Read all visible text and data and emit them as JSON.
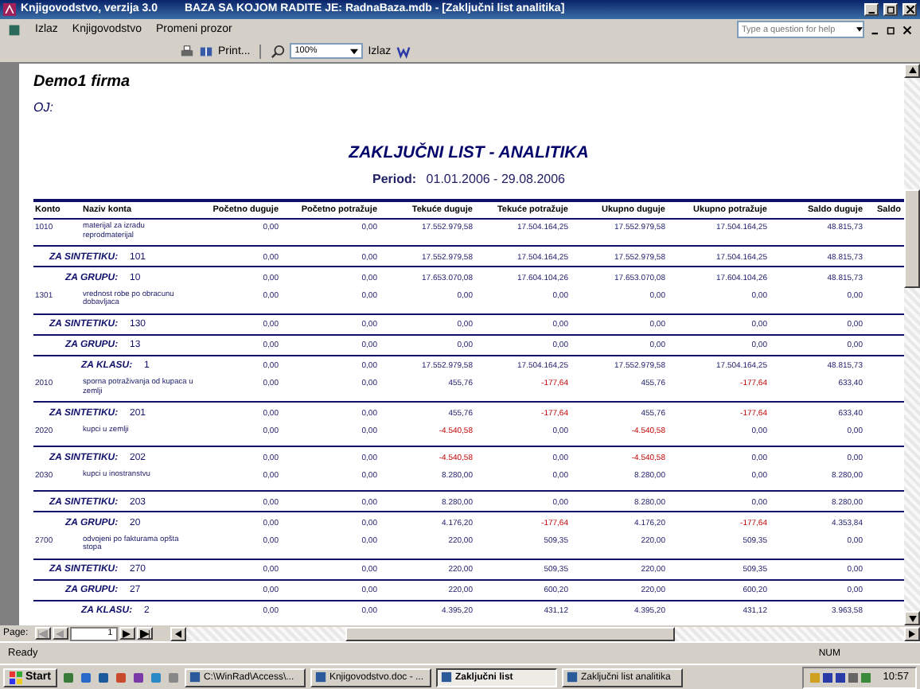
{
  "window": {
    "title": "Knjigovodstvo, verzija 3.0",
    "db_info": "BAZA SA KOJOM RADITE JE: RadnaBaza.mdb - [Zaključni list analitika]"
  },
  "menu": [
    "Izlaz",
    "Knjigovodstvo",
    "Promeni prozor"
  ],
  "help": {
    "placeholder": "Type a question for help"
  },
  "toolbar": {
    "print_label": "Print...",
    "zoom": "100%",
    "exit_label": "Izlaz"
  },
  "report": {
    "company": "Demo1 firma",
    "unit_label": "OJ:",
    "title": "ZAKLJUČNI LIST - ANALITIKA",
    "period_label": "Period:",
    "period": "01.01.2006 - 29.08.2006",
    "columns": [
      "Konto",
      "Naziv konta",
      "Početno duguje",
      "Početno potražuje",
      "Tekuće duguje",
      "Tekuće potražuje",
      "Ukupno duguje",
      "Ukupno potražuje",
      "Saldo duguje",
      "Saldo"
    ],
    "rows": [
      {
        "kind": "account",
        "code": "1010",
        "name": "materijal za izradu reprodmaterijal",
        "values": [
          {
            "text": "0,00",
            "negative": false
          },
          {
            "text": "0,00",
            "negative": false
          },
          {
            "text": "17.552.979,58",
            "negative": false
          },
          {
            "text": "17.504.164,25",
            "negative": false
          },
          {
            "text": "17.552.979,58",
            "negative": false
          },
          {
            "text": "17.504.164,25",
            "negative": false
          },
          {
            "text": "48.815,73",
            "negative": false
          }
        ]
      },
      {
        "kind": "synthetic",
        "label": "ZA SINTETIKU:",
        "code": "101",
        "values": [
          {
            "text": "0,00",
            "negative": false
          },
          {
            "text": "0,00",
            "negative": false
          },
          {
            "text": "17.552.979,58",
            "negative": false
          },
          {
            "text": "17.504.164,25",
            "negative": false
          },
          {
            "text": "17.552.979,58",
            "negative": false
          },
          {
            "text": "17.504.164,25",
            "negative": false
          },
          {
            "text": "48.815,73",
            "negative": false
          }
        ]
      },
      {
        "kind": "group",
        "label": "ZA GRUPU:",
        "code": "10",
        "values": [
          {
            "text": "0,00",
            "negative": false
          },
          {
            "text": "0,00",
            "negative": false
          },
          {
            "text": "17.653.070,08",
            "negative": false
          },
          {
            "text": "17.604.104,26",
            "negative": false
          },
          {
            "text": "17.653.070,08",
            "negative": false
          },
          {
            "text": "17.604.104,26",
            "negative": false
          },
          {
            "text": "48.815,73",
            "negative": false
          }
        ]
      },
      {
        "kind": "account",
        "code": "1301",
        "name": "vrednost robe po obracunu dobavljaca",
        "values": [
          {
            "text": "0,00",
            "negative": false
          },
          {
            "text": "0,00",
            "negative": false
          },
          {
            "text": "0,00",
            "negative": false
          },
          {
            "text": "0,00",
            "negative": false
          },
          {
            "text": "0,00",
            "negative": false
          },
          {
            "text": "0,00",
            "negative": false
          },
          {
            "text": "0,00",
            "negative": false
          }
        ]
      },
      {
        "kind": "synthetic",
        "label": "ZA SINTETIKU:",
        "code": "130",
        "values": [
          {
            "text": "0,00",
            "negative": false
          },
          {
            "text": "0,00",
            "negative": false
          },
          {
            "text": "0,00",
            "negative": false
          },
          {
            "text": "0,00",
            "negative": false
          },
          {
            "text": "0,00",
            "negative": false
          },
          {
            "text": "0,00",
            "negative": false
          },
          {
            "text": "0,00",
            "negative": false
          }
        ]
      },
      {
        "kind": "group",
        "label": "ZA GRUPU:",
        "code": "13",
        "values": [
          {
            "text": "0,00",
            "negative": false
          },
          {
            "text": "0,00",
            "negative": false
          },
          {
            "text": "0,00",
            "negative": false
          },
          {
            "text": "0,00",
            "negative": false
          },
          {
            "text": "0,00",
            "negative": false
          },
          {
            "text": "0,00",
            "negative": false
          },
          {
            "text": "0,00",
            "negative": false
          }
        ]
      },
      {
        "kind": "class",
        "label": "ZA KLASU:",
        "code": "1",
        "values": [
          {
            "text": "0,00",
            "negative": false
          },
          {
            "text": "0,00",
            "negative": false
          },
          {
            "text": "17.552.979,58",
            "negative": false
          },
          {
            "text": "17.504.164,25",
            "negative": false
          },
          {
            "text": "17.552.979,58",
            "negative": false
          },
          {
            "text": "17.504.164,25",
            "negative": false
          },
          {
            "text": "48.815,73",
            "negative": false
          }
        ]
      },
      {
        "kind": "account",
        "code": "2010",
        "name": "sporna potraživanja od kupaca u zemlji",
        "values": [
          {
            "text": "0,00",
            "negative": false
          },
          {
            "text": "0,00",
            "negative": false
          },
          {
            "text": "455,76",
            "negative": false
          },
          {
            "text": "-177,64",
            "negative": true
          },
          {
            "text": "455,76",
            "negative": false
          },
          {
            "text": "-177,64",
            "negative": true
          },
          {
            "text": "633,40",
            "negative": false
          }
        ]
      },
      {
        "kind": "synthetic",
        "label": "ZA SINTETIKU:",
        "code": "201",
        "values": [
          {
            "text": "0,00",
            "negative": false
          },
          {
            "text": "0,00",
            "negative": false
          },
          {
            "text": "455,76",
            "negative": false
          },
          {
            "text": "-177,64",
            "negative": true
          },
          {
            "text": "455,76",
            "negative": false
          },
          {
            "text": "-177,64",
            "negative": true
          },
          {
            "text": "633,40",
            "negative": false
          }
        ]
      },
      {
        "kind": "account",
        "code": "2020",
        "name": "kupci u zemlji",
        "values": [
          {
            "text": "0,00",
            "negative": false
          },
          {
            "text": "0,00",
            "negative": false
          },
          {
            "text": "-4.540,58",
            "negative": true
          },
          {
            "text": "0,00",
            "negative": false
          },
          {
            "text": "-4.540,58",
            "negative": true
          },
          {
            "text": "0,00",
            "negative": false
          },
          {
            "text": "0,00",
            "negative": false
          }
        ]
      },
      {
        "kind": "synthetic",
        "label": "ZA SINTETIKU:",
        "code": "202",
        "values": [
          {
            "text": "0,00",
            "negative": false
          },
          {
            "text": "0,00",
            "negative": false
          },
          {
            "text": "-4.540,58",
            "negative": true
          },
          {
            "text": "0,00",
            "negative": false
          },
          {
            "text": "-4.540,58",
            "negative": true
          },
          {
            "text": "0,00",
            "negative": false
          },
          {
            "text": "0,00",
            "negative": false
          }
        ]
      },
      {
        "kind": "account",
        "code": "2030",
        "name": "kupci u inostranstvu",
        "values": [
          {
            "text": "0,00",
            "negative": false
          },
          {
            "text": "0,00",
            "negative": false
          },
          {
            "text": "8.280,00",
            "negative": false
          },
          {
            "text": "0,00",
            "negative": false
          },
          {
            "text": "8.280,00",
            "negative": false
          },
          {
            "text": "0,00",
            "negative": false
          },
          {
            "text": "8.280,00",
            "negative": false
          }
        ]
      },
      {
        "kind": "synthetic",
        "label": "ZA SINTETIKU:",
        "code": "203",
        "values": [
          {
            "text": "0,00",
            "negative": false
          },
          {
            "text": "0,00",
            "negative": false
          },
          {
            "text": "8.280,00",
            "negative": false
          },
          {
            "text": "0,00",
            "negative": false
          },
          {
            "text": "8.280,00",
            "negative": false
          },
          {
            "text": "0,00",
            "negative": false
          },
          {
            "text": "8.280,00",
            "negative": false
          }
        ]
      },
      {
        "kind": "group",
        "label": "ZA GRUPU:",
        "code": "20",
        "values": [
          {
            "text": "0,00",
            "negative": false
          },
          {
            "text": "0,00",
            "negative": false
          },
          {
            "text": "4.176,20",
            "negative": false
          },
          {
            "text": "-177,64",
            "negative": true
          },
          {
            "text": "4.176,20",
            "negative": false
          },
          {
            "text": "-177,64",
            "negative": true
          },
          {
            "text": "4.353,84",
            "negative": false
          }
        ]
      },
      {
        "kind": "account",
        "code": "2700",
        "name": "odvojeni po fakturama opšta stopa",
        "values": [
          {
            "text": "0,00",
            "negative": false
          },
          {
            "text": "0,00",
            "negative": false
          },
          {
            "text": "220,00",
            "negative": false
          },
          {
            "text": "509,35",
            "negative": false
          },
          {
            "text": "220,00",
            "negative": false
          },
          {
            "text": "509,35",
            "negative": false
          },
          {
            "text": "0,00",
            "negative": false
          }
        ]
      },
      {
        "kind": "synthetic",
        "label": "ZA SINTETIKU:",
        "code": "270",
        "values": [
          {
            "text": "0,00",
            "negative": false
          },
          {
            "text": "0,00",
            "negative": false
          },
          {
            "text": "220,00",
            "negative": false
          },
          {
            "text": "509,35",
            "negative": false
          },
          {
            "text": "220,00",
            "negative": false
          },
          {
            "text": "509,35",
            "negative": false
          },
          {
            "text": "0,00",
            "negative": false
          }
        ]
      },
      {
        "kind": "group",
        "label": "ZA GRUPU:",
        "code": "27",
        "values": [
          {
            "text": "0,00",
            "negative": false
          },
          {
            "text": "0,00",
            "negative": false
          },
          {
            "text": "220,00",
            "negative": false
          },
          {
            "text": "600,20",
            "negative": false
          },
          {
            "text": "220,00",
            "negative": false
          },
          {
            "text": "600,20",
            "negative": false
          },
          {
            "text": "0,00",
            "negative": false
          }
        ]
      },
      {
        "kind": "class",
        "label": "ZA KLASU:",
        "code": "2",
        "values": [
          {
            "text": "0,00",
            "negative": false
          },
          {
            "text": "0,00",
            "negative": false
          },
          {
            "text": "4.395,20",
            "negative": false
          },
          {
            "text": "431,12",
            "negative": false
          },
          {
            "text": "4.395,20",
            "negative": false
          },
          {
            "text": "431,12",
            "negative": false
          },
          {
            "text": "3.963,58",
            "negative": false
          }
        ]
      }
    ]
  },
  "pager": {
    "label": "Page:",
    "page": "1"
  },
  "status_bar": {
    "text": "Ready",
    "indicator": "NUM"
  },
  "taskbar": {
    "start": "Start",
    "tasks": [
      {
        "label": "C:\\WinRad\\Access\\...",
        "selected": false
      },
      {
        "label": "Knjigovodstvo.doc - ...",
        "selected": false
      },
      {
        "label": "Zaključni list",
        "selected": true
      },
      {
        "label": "Zaključni list analitika",
        "selected": false
      }
    ],
    "clock": "10:57"
  }
}
